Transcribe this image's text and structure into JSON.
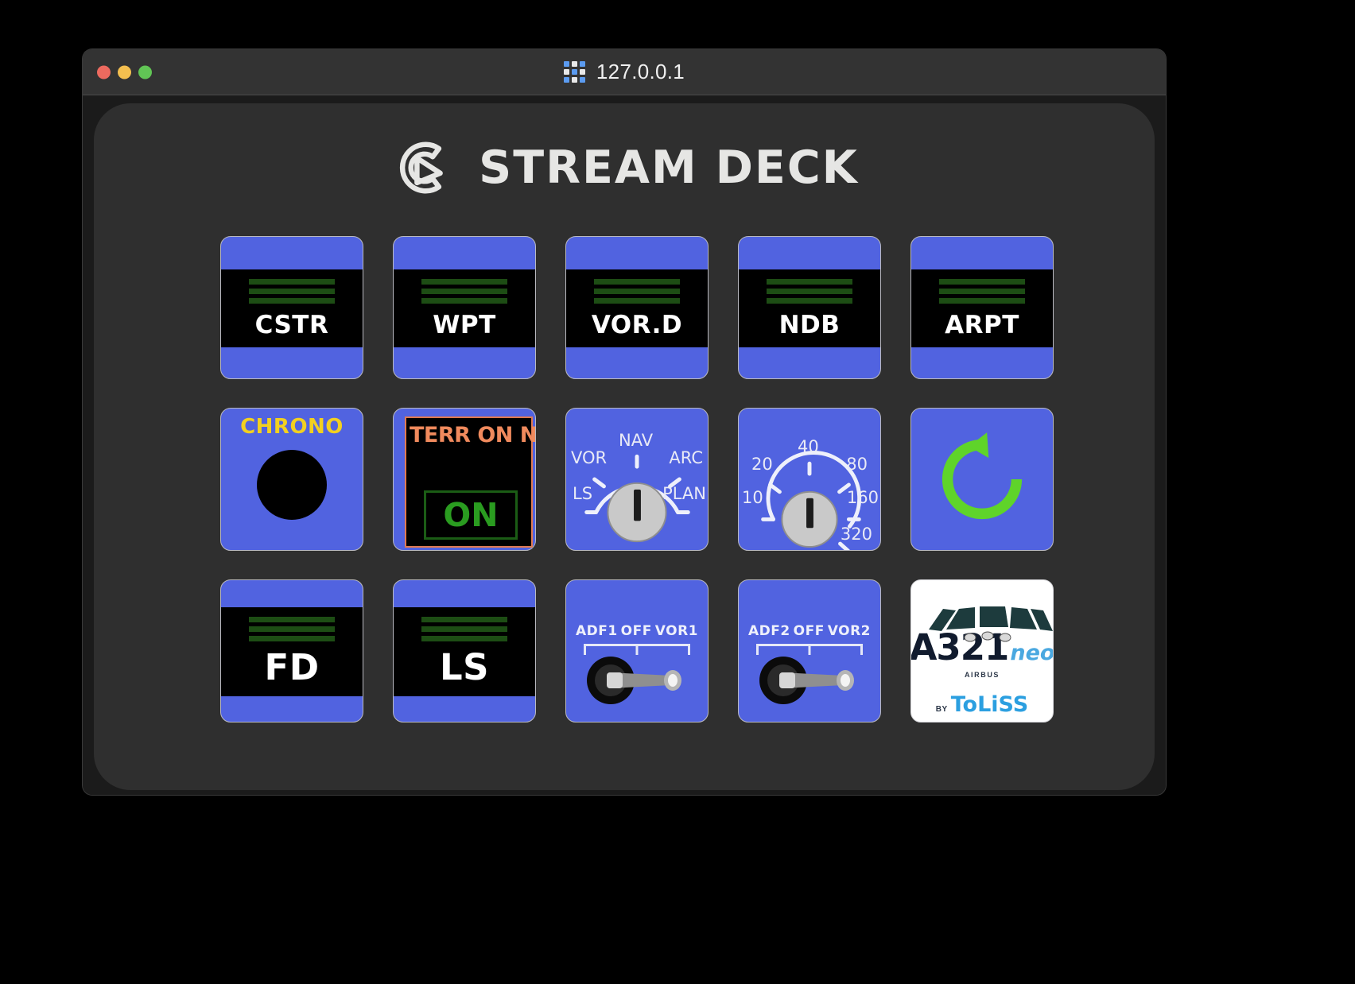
{
  "window": {
    "title": "127.0.0.1",
    "title_icon": "grid-icon",
    "traffic_lights": [
      {
        "name": "close",
        "color": "#ed6a5f"
      },
      {
        "name": "minimize",
        "color": "#f4bf4f"
      },
      {
        "name": "maximize",
        "color": "#61c555"
      }
    ]
  },
  "app": {
    "brand": "STREAM DECK",
    "brand_icon": "elgato-logo-icon",
    "panel_color": "#2f2f2f",
    "key_color": "#5163e0"
  },
  "keys": {
    "row1": [
      {
        "label": "CSTR",
        "name": "key-cstr",
        "style": "nd-symbol"
      },
      {
        "label": "WPT",
        "name": "key-wpt",
        "style": "nd-symbol"
      },
      {
        "label": "VOR.D",
        "name": "key-vor-d",
        "style": "nd-symbol"
      },
      {
        "label": "NDB",
        "name": "key-ndb",
        "style": "nd-symbol"
      },
      {
        "label": "ARPT",
        "name": "key-arpt",
        "style": "nd-symbol"
      }
    ],
    "chrono": {
      "label": "CHRONO",
      "label_color": "#f2d020"
    },
    "terr": {
      "title": "TERR ON ND",
      "state": "ON",
      "border_color": "#e07a52",
      "state_color": "#2a9c20"
    },
    "nd_mode_knob": {
      "positions": [
        "LS",
        "VOR",
        "NAV",
        "ARC",
        "PLAN"
      ],
      "selected": "NAV"
    },
    "nd_range_knob": {
      "positions": [
        "10",
        "20",
        "40",
        "80",
        "160",
        "320"
      ],
      "selected": "40"
    },
    "refresh": {
      "icon": "refresh-icon",
      "color": "#5fd42a"
    },
    "row3": [
      {
        "label": "FD",
        "name": "key-fd",
        "style": "nd-symbol"
      },
      {
        "label": "LS",
        "name": "key-ls",
        "style": "nd-symbol"
      }
    ],
    "adf1": {
      "positions": [
        "ADF1",
        "OFF",
        "VOR1"
      ],
      "selected": "VOR1"
    },
    "adf2": {
      "positions": [
        "ADF2",
        "OFF",
        "VOR2"
      ],
      "selected": "VOR2"
    },
    "aircraft": {
      "model": "A321",
      "variant": "neo",
      "manufacturer": "AIRBUS",
      "by_prefix": "BY",
      "developer": "ToLiSS"
    }
  }
}
